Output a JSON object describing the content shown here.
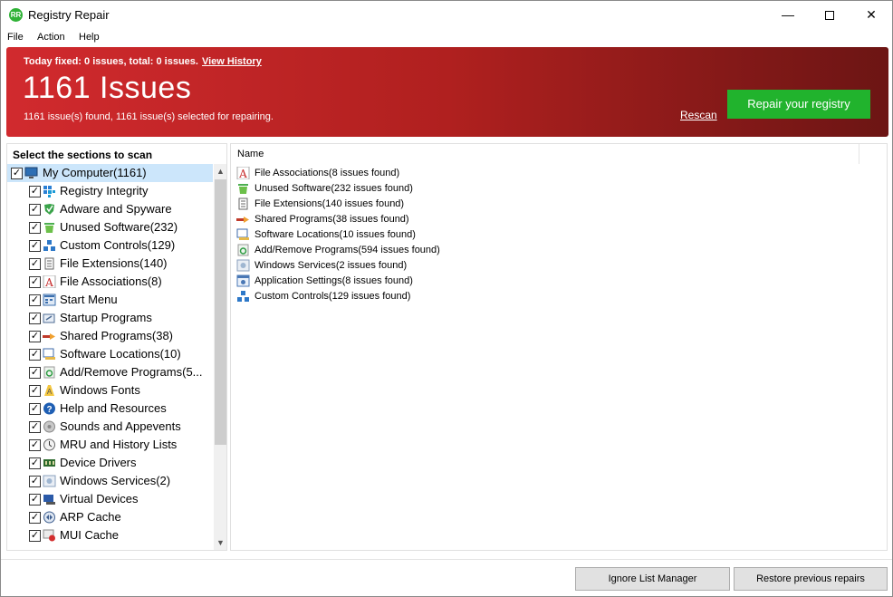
{
  "window": {
    "title": "Registry Repair",
    "app_icon_text": "RR",
    "minimize_glyph": "—",
    "close_glyph": "✕"
  },
  "menu": [
    "File",
    "Action",
    "Help"
  ],
  "banner": {
    "today_text": "Today fixed: 0 issues, total: 0 issues.",
    "view_history": "View History",
    "issues_title": "1161 Issues",
    "found_text": "1161 issue(s) found, 1161 issue(s) selected for repairing.",
    "rescan": "Rescan",
    "repair_button": "Repair your registry",
    "colors": {
      "banner_start": "#d12a2e",
      "banner_end": "#6c1514",
      "repair_button": "#21b32d"
    }
  },
  "sections": {
    "header": "Select the sections to scan",
    "root": {
      "label": "My Computer(1161)",
      "icon": "computer-icon",
      "checked": true
    },
    "items": [
      {
        "label": "Registry Integrity",
        "icon": "registry-icon",
        "checked": true
      },
      {
        "label": "Adware and Spyware",
        "icon": "shield-icon",
        "checked": true
      },
      {
        "label": "Unused Software(232)",
        "icon": "trash-icon",
        "checked": true
      },
      {
        "label": "Custom Controls(129)",
        "icon": "controls-icon",
        "checked": true
      },
      {
        "label": "File Extensions(140)",
        "icon": "file-icon",
        "checked": true
      },
      {
        "label": "File Associations(8)",
        "icon": "font-a-icon",
        "checked": true
      },
      {
        "label": "Start Menu",
        "icon": "start-menu-icon",
        "checked": true
      },
      {
        "label": "Startup Programs",
        "icon": "startup-icon",
        "checked": true
      },
      {
        "label": "Shared Programs(38)",
        "icon": "shared-icon",
        "checked": true
      },
      {
        "label": "Software Locations(10)",
        "icon": "folder-icon",
        "checked": true
      },
      {
        "label": "Add/Remove Programs(5...",
        "icon": "recycle-icon",
        "checked": true
      },
      {
        "label": "Windows Fonts",
        "icon": "fonts-icon",
        "checked": true
      },
      {
        "label": "Help and Resources",
        "icon": "help-icon",
        "checked": true
      },
      {
        "label": "Sounds and Appevents",
        "icon": "sound-icon",
        "checked": true
      },
      {
        "label": "MRU and History Lists",
        "icon": "history-icon",
        "checked": true
      },
      {
        "label": "Device Drivers",
        "icon": "driver-icon",
        "checked": true
      },
      {
        "label": "Windows Services(2)",
        "icon": "services-icon",
        "checked": true
      },
      {
        "label": "Virtual Devices",
        "icon": "virtual-icon",
        "checked": true
      },
      {
        "label": "ARP Cache",
        "icon": "arp-icon",
        "checked": true
      },
      {
        "label": "MUI Cache",
        "icon": "mui-icon",
        "checked": true
      }
    ]
  },
  "results": {
    "column_name": "Name",
    "items": [
      {
        "label": "File Associations(8 issues found)",
        "icon": "font-a-icon"
      },
      {
        "label": "Unused Software(232 issues found)",
        "icon": "trash-icon"
      },
      {
        "label": "File Extensions(140 issues found)",
        "icon": "file-icon"
      },
      {
        "label": "Shared Programs(38 issues found)",
        "icon": "shared-icon"
      },
      {
        "label": "Software Locations(10 issues found)",
        "icon": "folder-icon"
      },
      {
        "label": "Add/Remove Programs(594 issues found)",
        "icon": "recycle-icon"
      },
      {
        "label": "Windows Services(2 issues found)",
        "icon": "services-icon"
      },
      {
        "label": "Application Settings(8 issues found)",
        "icon": "settings-icon"
      },
      {
        "label": "Custom Controls(129 issues found)",
        "icon": "controls-icon"
      }
    ]
  },
  "footer": {
    "ignore_list": "Ignore List Manager",
    "restore": "Restore previous repairs"
  }
}
